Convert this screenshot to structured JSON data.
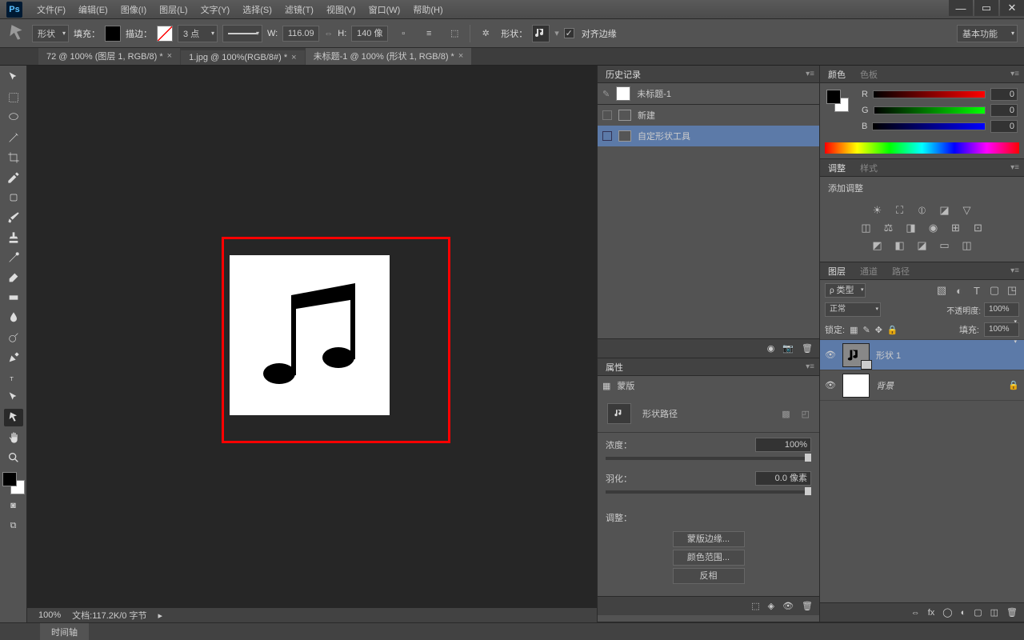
{
  "menu": {
    "items": [
      "文件(F)",
      "编辑(E)",
      "图像(I)",
      "图层(L)",
      "文字(Y)",
      "选择(S)",
      "滤镜(T)",
      "视图(V)",
      "窗口(W)",
      "帮助(H)"
    ]
  },
  "options": {
    "mode": "形状",
    "fill": "填充：",
    "stroke": "描边：",
    "strokeWidth": "3 点",
    "wLabel": "W:",
    "wVal": "116.09",
    "hLabel": "H:",
    "hVal": "140 像",
    "shapeLabel": "形状：",
    "alignEdges": "对齐边缘",
    "workspace": "基本功能"
  },
  "tabs": [
    {
      "label": "72 @ 100% (图层 1, RGB/8) *",
      "active": false
    },
    {
      "label": "1.jpg @ 100%(RGB/8#) *",
      "active": false
    },
    {
      "label": "未标题-1 @ 100% (形状 1, RGB/8) *",
      "active": true
    }
  ],
  "canvas": {
    "zoom": "100%",
    "docInfo": "文档:117.2K/0 字节"
  },
  "history": {
    "title": "历史记录",
    "doc": "未标题-1",
    "items": [
      "新建",
      "自定形状工具"
    ]
  },
  "properties": {
    "title": "属性",
    "mask": "蒙版",
    "path": "形状路径",
    "density": "浓度：",
    "densityVal": "100%",
    "feather": "羽化：",
    "featherVal": "0.0 像素",
    "adjust": "调整：",
    "btnMask": "蒙版边缘...",
    "btnColor": "颜色范围...",
    "btnInvert": "反相"
  },
  "color": {
    "title": "颜色",
    "swatches": "色板",
    "r": "R",
    "g": "G",
    "b": "B",
    "rv": "0",
    "gv": "0",
    "bv": "0"
  },
  "adjustments": {
    "title": "调整",
    "styles": "样式",
    "add": "添加调整"
  },
  "layers": {
    "title": "图层",
    "channels": "通道",
    "paths": "路径",
    "kind": "类型",
    "mode": "正常",
    "opacityLabel": "不透明度:",
    "opacity": "100%",
    "lockLabel": "锁定:",
    "fillLabel": "填充:",
    "fill": "100%",
    "items": [
      {
        "name": "形状 1",
        "sel": true
      },
      {
        "name": "背景",
        "sel": false,
        "italic": true,
        "lock": true
      }
    ]
  },
  "statusbar": {
    "timeline": "时间轴"
  }
}
